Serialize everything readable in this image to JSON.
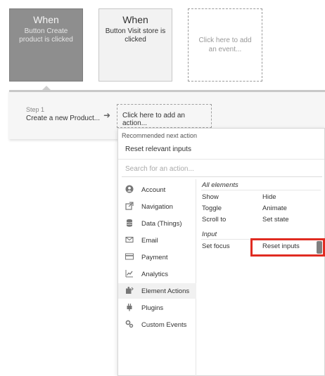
{
  "events": [
    {
      "title": "When",
      "description": "Button Create product is clicked"
    },
    {
      "title": "When",
      "description": "Button Visit store is clicked"
    },
    {
      "add_text": "Click here to add an event..."
    }
  ],
  "workflow": {
    "step_number": "Step 1",
    "step_name": "Create a new Product...",
    "add_action": "Click here to add an action..."
  },
  "dropdown": {
    "recommended_title": "Recommended next action",
    "recommended_item": "Reset relevant inputs",
    "search_placeholder": "Search for an action...",
    "categories": [
      {
        "label": "Account",
        "icon": "account-icon"
      },
      {
        "label": "Navigation",
        "icon": "navigation-icon"
      },
      {
        "label": "Data (Things)",
        "icon": "database-icon"
      },
      {
        "label": "Email",
        "icon": "email-icon"
      },
      {
        "label": "Payment",
        "icon": "payment-icon"
      },
      {
        "label": "Analytics",
        "icon": "analytics-icon"
      },
      {
        "label": "Element Actions",
        "icon": "element-actions-icon",
        "active": true
      },
      {
        "label": "Plugins",
        "icon": "plugins-icon"
      },
      {
        "label": "Custom Events",
        "icon": "custom-events-icon"
      }
    ],
    "sections": [
      {
        "heading": "All elements",
        "actions": [
          "Show",
          "Hide",
          "Toggle",
          "Animate",
          "Scroll to",
          "Set state"
        ]
      },
      {
        "heading": "Input",
        "actions": [
          "Set focus",
          "Reset inputs"
        ]
      }
    ],
    "highlight_color": "#e02b21"
  }
}
